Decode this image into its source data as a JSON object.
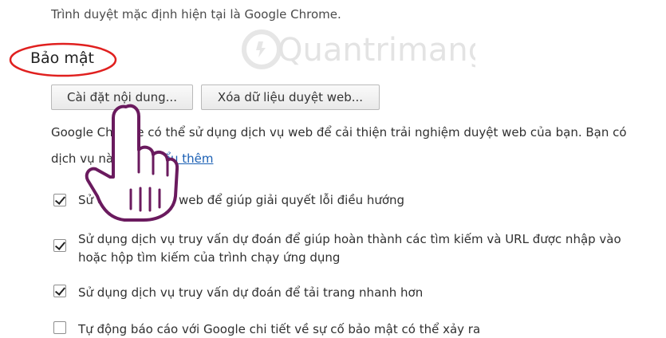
{
  "default_browser_text": "Trình duyệt mặc định hiện tại là Google Chrome.",
  "privacy": {
    "title": "Bảo mật",
    "content_settings_label": "Cài đặt nội dung...",
    "clear_data_label": "Xóa dữ liệu duyệt web...",
    "info_line1": "Google Chrome có thể sử dụng dịch vụ web để cải thiện trải nghiệm duyệt web của bạn. Bạn có",
    "info_line2_prefix": "dịch vụ này. ",
    "learn_more": "Tìm hiểu thêm",
    "options": [
      {
        "label": "Sử dụng dịch vụ web để giúp giải quyết lỗi điều hướng",
        "checked": true
      },
      {
        "label_line1": "Sử dụng dịch vụ truy vấn dự đoán để giúp hoàn thành các tìm kiếm và URL được nhập vào",
        "label_line2": "hoặc hộp tìm kiếm của trình chạy ứng dụng",
        "checked": true
      },
      {
        "label": "Sử dụng dịch vụ truy vấn dự đoán để tải trang nhanh hơn",
        "checked": true
      },
      {
        "label": "Tự động báo cáo với Google chi tiết về sự cố bảo mật có thể xảy ra",
        "checked": false
      }
    ]
  },
  "overlay": {
    "watermark_text": "Quantrimang",
    "hand_icon": "pointing-hand-icon",
    "highlight_color": "#e0201f"
  }
}
